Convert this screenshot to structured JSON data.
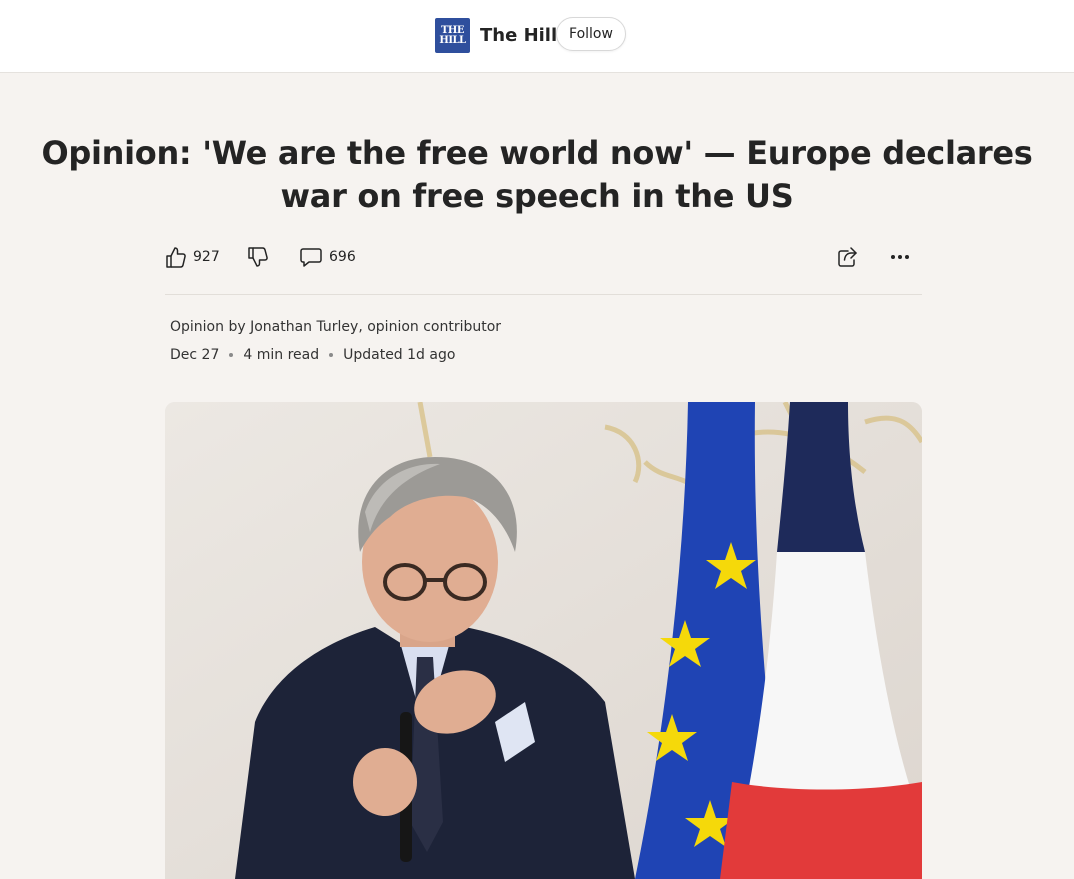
{
  "publisher": {
    "logo_text_line1": "THE",
    "logo_text_line2": "HILL",
    "name": "The Hill",
    "follow_label": "Follow"
  },
  "article": {
    "title": "Opinion: 'We are the free world now' — Europe declares war on free speech in the US",
    "likes": "927",
    "comments": "696",
    "byline": "Opinion by Jonathan Turley, opinion contributor",
    "date": "Dec 27",
    "read_time": "4 min read",
    "updated": "Updated 1d ago"
  },
  "icons": {
    "like": "thumbs-up-icon",
    "dislike": "thumbs-down-icon",
    "comment": "comment-icon",
    "share": "share-icon",
    "more": "more-icon"
  },
  "colors": {
    "background": "#f6f3f0",
    "brand_blue": "#2f4f9d",
    "eu_blue": "#1f44b4",
    "eu_star": "#f5d90a",
    "fr_red": "#e23a3a"
  }
}
